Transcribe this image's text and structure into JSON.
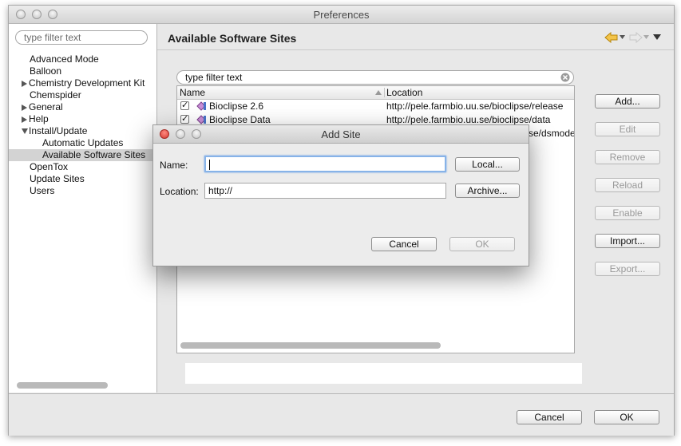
{
  "window": {
    "title": "Preferences",
    "filter_placeholder": "type filter text",
    "tree": [
      {
        "label": "Advanced Mode",
        "expander": ""
      },
      {
        "label": "Balloon",
        "expander": ""
      },
      {
        "label": "Chemistry Development Kit",
        "expander": "collapsed"
      },
      {
        "label": "Chemspider",
        "expander": ""
      },
      {
        "label": "General",
        "expander": "collapsed"
      },
      {
        "label": "Help",
        "expander": "collapsed"
      },
      {
        "label": "Install/Update",
        "expander": "expanded"
      },
      {
        "label": "Automatic Updates",
        "expander": "",
        "child": true
      },
      {
        "label": "Available Software Sites",
        "expander": "",
        "child": true,
        "selected": true
      },
      {
        "label": "OpenTox",
        "expander": ""
      },
      {
        "label": "Update Sites",
        "expander": ""
      },
      {
        "label": "Users",
        "expander": ""
      }
    ]
  },
  "page": {
    "title": "Available Software Sites",
    "filter_text": "type filter text",
    "table": {
      "columns": [
        "Name",
        "Location"
      ],
      "rows": [
        {
          "checked": true,
          "name": "Bioclipse 2.6",
          "location": "http://pele.farmbio.uu.se/bioclipse/release"
        },
        {
          "checked": true,
          "name": "Bioclipse Data",
          "location": "http://pele.farmbio.uu.se/bioclipse/data"
        },
        {
          "checked": true,
          "name": "",
          "location": "http://pele.farmbio.uu.se/dsmodel"
        }
      ],
      "row3_visible_location": "se/dsmode"
    },
    "buttons": {
      "add": "Add...",
      "edit": "Edit",
      "remove": "Remove",
      "reload": "Reload",
      "enable": "Enable",
      "import": "Import...",
      "export": "Export..."
    }
  },
  "footer": {
    "cancel": "Cancel",
    "ok": "OK"
  },
  "dialog": {
    "title": "Add Site",
    "name_label": "Name:",
    "name_value": "",
    "location_label": "Location:",
    "location_value": "http://",
    "local_button": "Local...",
    "archive_button": "Archive...",
    "cancel": "Cancel",
    "ok": "OK"
  },
  "colors": {
    "close_red": "#e0443e",
    "focus_ring": "#87b3e8",
    "selection": "#d3d3d3",
    "nav_arrow": "#e8a317"
  },
  "icons": [
    "back-arrow-icon",
    "forward-arrow-icon",
    "view-menu-icon",
    "clear-search-icon",
    "site-icon",
    "sort-arrow-icon"
  ]
}
